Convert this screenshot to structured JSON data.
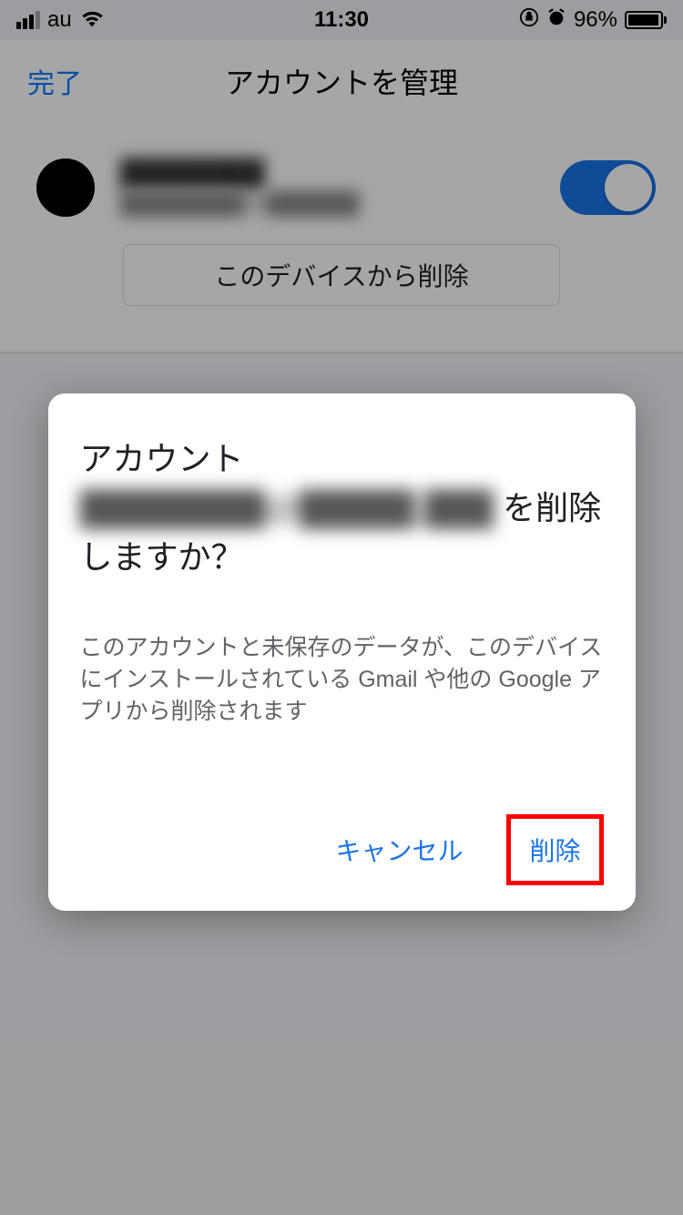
{
  "status_bar": {
    "carrier": "au",
    "time": "11:30",
    "battery_percent": "96%"
  },
  "nav": {
    "done": "完了",
    "title": "アカウントを管理"
  },
  "account": {
    "name": "████████",
    "email": "████████@██████",
    "remove_button": "このデバイスから削除"
  },
  "dialog": {
    "title_prefix": "アカウント",
    "title_email": "████████@█████.███",
    "title_suffix": "を削除しますか？",
    "body": "このアカウントと未保存のデータが、このデバイスにインストールされている Gmail や他の Google アプリから削除されます",
    "cancel": "キャンセル",
    "confirm": "削除"
  }
}
